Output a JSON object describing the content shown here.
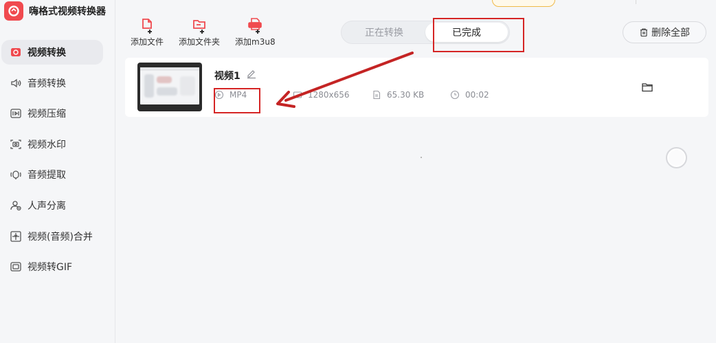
{
  "app": {
    "title": "嗨格式视频转换器"
  },
  "sidebar": {
    "items": [
      {
        "label": "视频转换",
        "icon": "video-convert-icon",
        "active": true
      },
      {
        "label": "音频转换",
        "icon": "audio-convert-icon"
      },
      {
        "label": "视频压缩",
        "icon": "video-compress-icon"
      },
      {
        "label": "视频水印",
        "icon": "video-watermark-icon"
      },
      {
        "label": "音频提取",
        "icon": "audio-extract-icon"
      },
      {
        "label": "人声分离",
        "icon": "voice-separate-icon"
      },
      {
        "label": "视频(音频)合并",
        "icon": "merge-icon"
      },
      {
        "label": "视频转GIF",
        "icon": "gif-icon"
      }
    ]
  },
  "toolbar": {
    "add_file": "添加文件",
    "add_folder": "添加文件夹",
    "add_m3u8": "添加m3u8"
  },
  "tabs": {
    "converting": "正在转换",
    "completed": "已完成"
  },
  "delete_all": "删除全部",
  "files": [
    {
      "name": "视频1",
      "format": "MP4",
      "resolution": "1280x656",
      "size": "65.30 KB",
      "duration": "00:02"
    }
  ],
  "colors": {
    "accent": "#f04a4f",
    "annotation": "#d52424"
  }
}
